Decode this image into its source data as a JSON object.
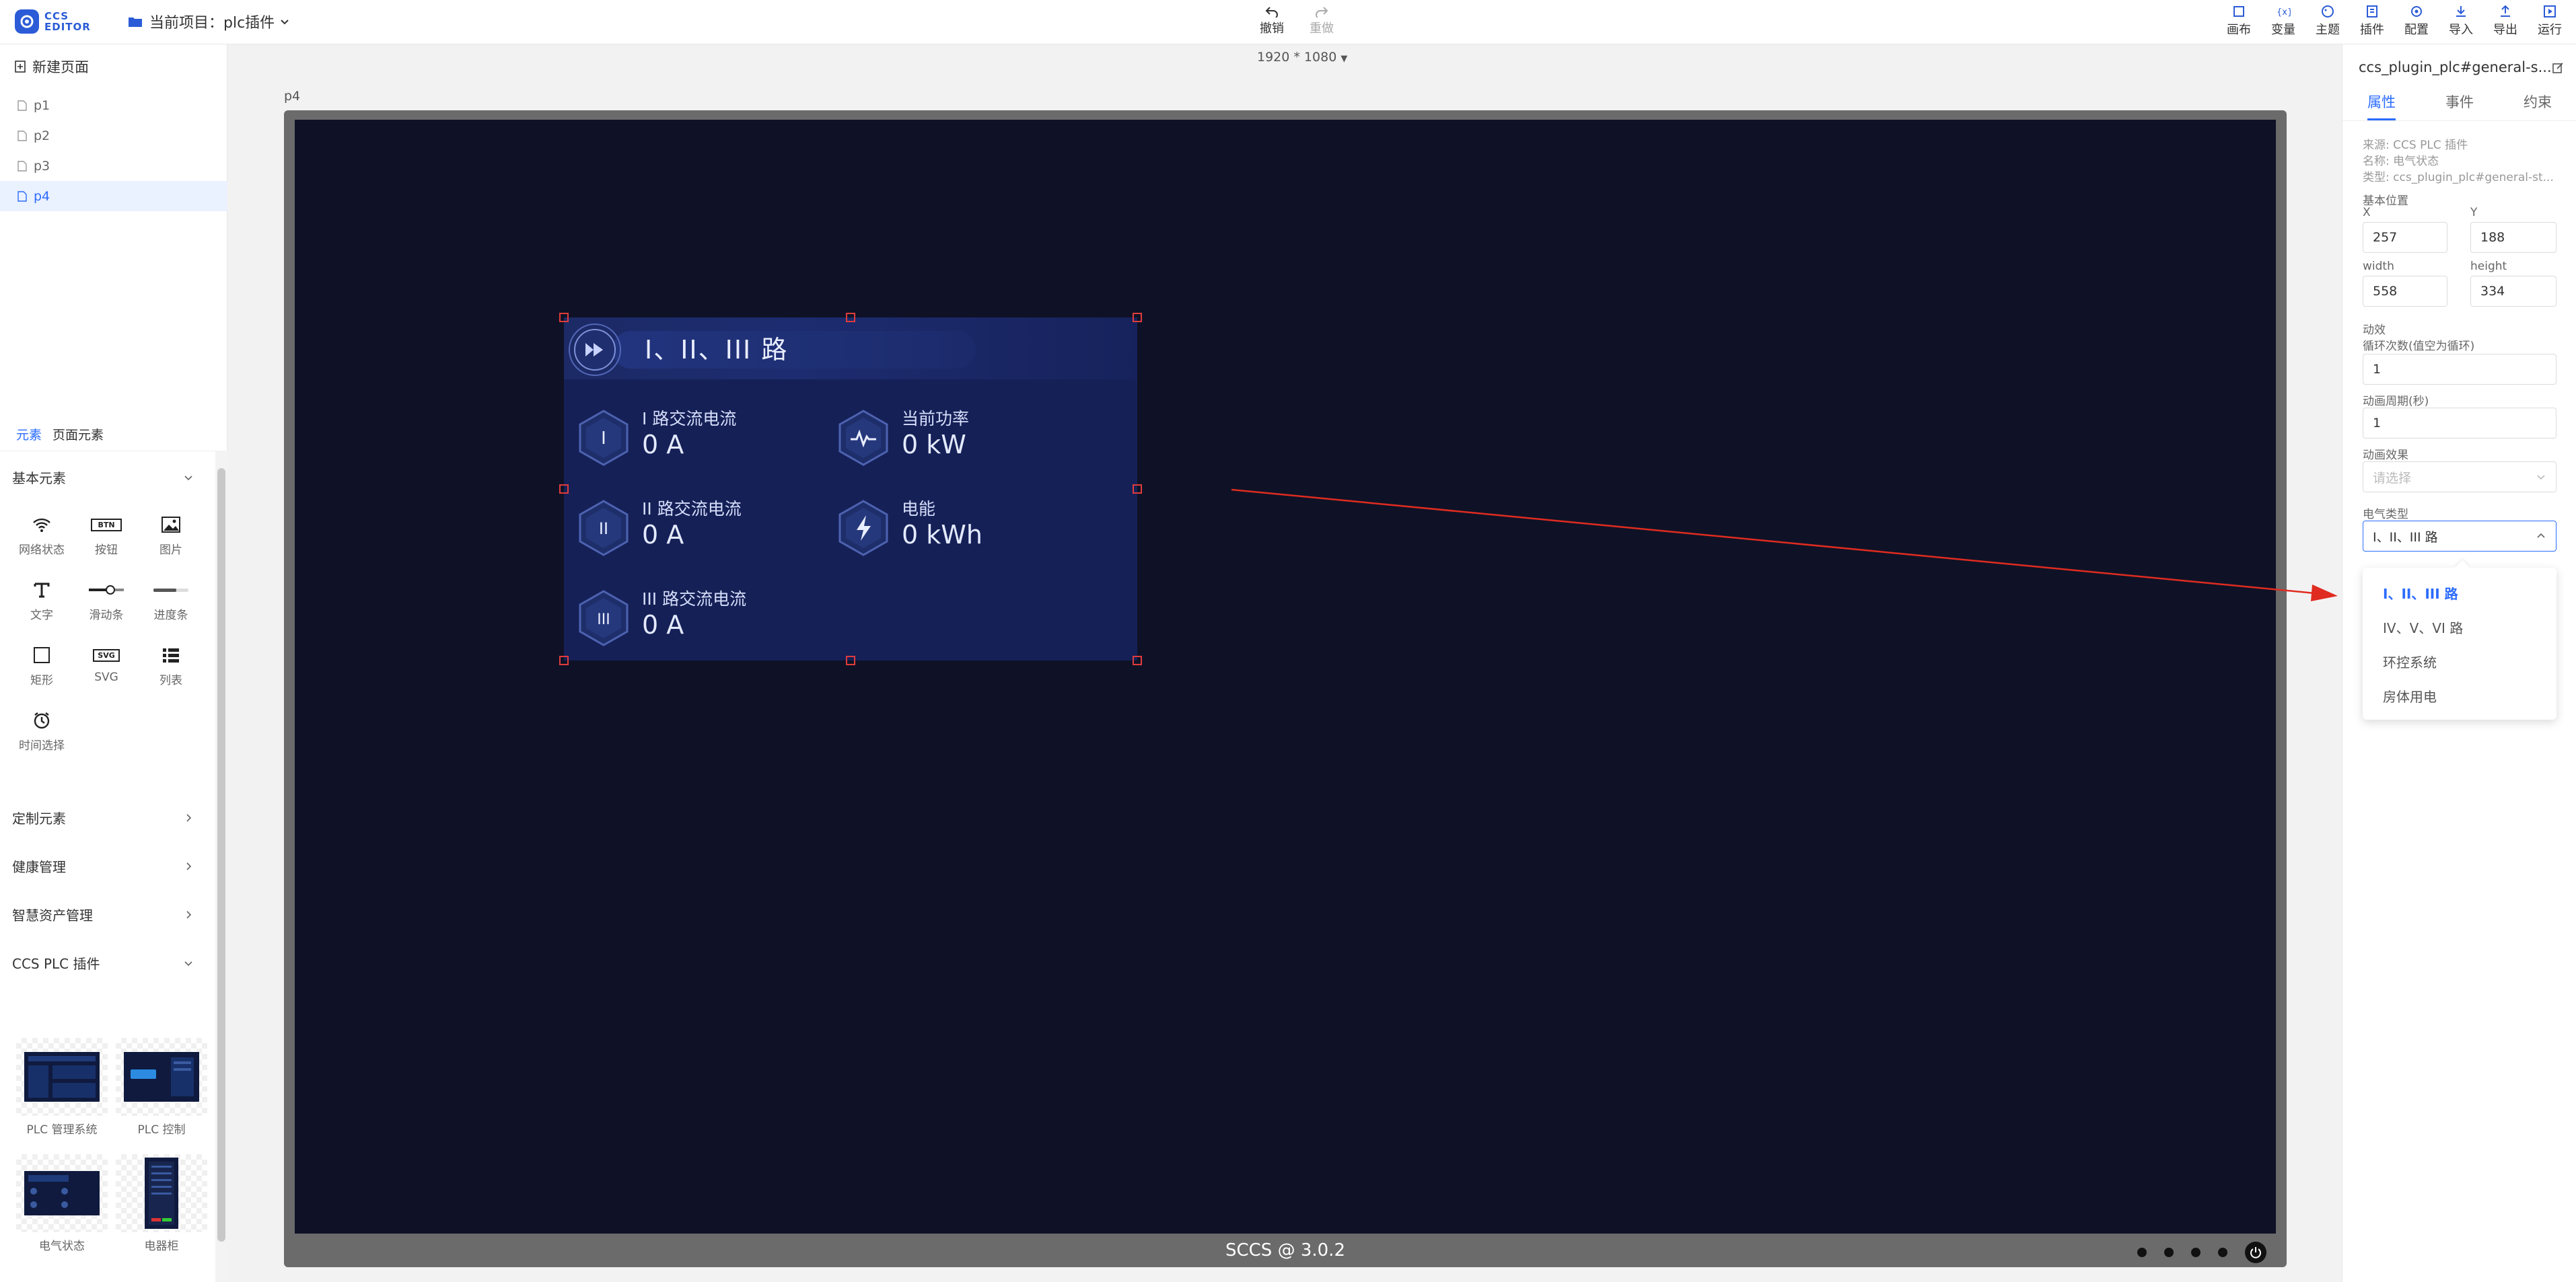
{
  "app": {
    "logo_text_1": "CCS",
    "logo_text_2": "EDITOR",
    "project_label": "当前项目：plc插件"
  },
  "toolbar": {
    "undo": "撤销",
    "redo": "重做"
  },
  "right_tools": [
    "画布",
    "变量",
    "主题",
    "插件",
    "配置",
    "导入",
    "导出",
    "运行"
  ],
  "sidebar": {
    "new_page": "新建页面",
    "pages": [
      "p1",
      "p2",
      "p3",
      "p4"
    ],
    "active_page": "p4",
    "tabs": [
      "元素",
      "页面元素"
    ],
    "sections": {
      "basic": "基本元素",
      "custom": "定制元素",
      "health": "健康管理",
      "asset": "智慧资产管理",
      "plc": "CCS PLC 插件"
    },
    "elements": [
      "网络状态",
      "按钮",
      "图片",
      "文字",
      "滑动条",
      "进度条",
      "矩形",
      "SVG",
      "列表",
      "时间选择"
    ],
    "btn_icon_text": "BTN",
    "svg_icon_text": "SVG",
    "plugins": [
      "PLC 管理系统",
      "PLC 控制",
      "电气状态",
      "电器柜"
    ]
  },
  "canvas": {
    "resolution": "1920 * 1080",
    "page_name": "p4",
    "footer": "SCCS @ 3.0.2",
    "widget": {
      "title": "I、II、III 路",
      "metrics": [
        {
          "label": "I 路交流电流",
          "value": "0 A",
          "icon": "I"
        },
        {
          "label": "II 路交流电流",
          "value": "0 A",
          "icon": "II"
        },
        {
          "label": "III 路交流电流",
          "value": "0 A",
          "icon": "III"
        },
        {
          "label": "当前功率",
          "value": "0 kW",
          "icon": "pulse-icon"
        },
        {
          "label": "电能",
          "value": "0 kWh",
          "icon": "lightning-icon"
        }
      ]
    }
  },
  "panel": {
    "component_id": "ccs_plugin_plc#general-s...",
    "tabs": [
      "属性",
      "事件",
      "约束"
    ],
    "info_source": "来源: CCS PLC 插件",
    "info_name": "名称: 电气状态",
    "info_type": "类型: ccs_plugin_plc#general-st...",
    "basic_pos": "基本位置",
    "x_label": "X",
    "x": "257",
    "y_label": "Y",
    "y": "188",
    "w_label": "width",
    "w": "558",
    "h_label": "height",
    "h": "334",
    "anim_label": "动效",
    "loop_label": "循环次数(值空为循环)",
    "loop": "1",
    "period_label": "动画周期(秒)",
    "period": "1",
    "effect_label": "动画效果",
    "effect_placeholder": "请选择",
    "etype_label": "电气类型",
    "etype": "I、II、III 路",
    "options": [
      "I、II、III 路",
      "IV、V、VI 路",
      "环控系统",
      "房体用电"
    ]
  },
  "colors": {
    "accent": "#2b6cff",
    "screen_bg": "#0f1226",
    "widget_bg": "#152057",
    "arrow": "#e02b20"
  }
}
